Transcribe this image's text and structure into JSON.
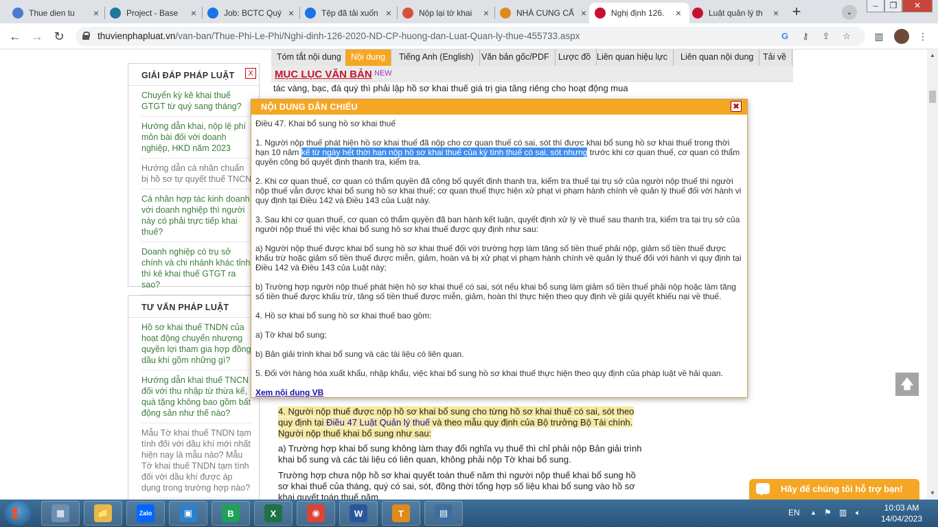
{
  "browser": {
    "tabs": [
      {
        "title": "Thue dien tu",
        "icon": "globe-icon",
        "color": "#4a7bd0"
      },
      {
        "title": "Project - Base",
        "icon": "wordpress-icon",
        "color": "#21759b"
      },
      {
        "title": "Job: BCTC Quý",
        "icon": "job-icon",
        "color": "#1a73e8"
      },
      {
        "title": "Tệp đã tải xuốn",
        "icon": "download-icon",
        "color": "#1a73e8"
      },
      {
        "title": "Nộp lại tờ khai",
        "icon": "tax-icon",
        "color": "#d4513d"
      },
      {
        "title": "NHÀ CUNG CẤ",
        "icon": "supplier-icon",
        "color": "#e08a1e"
      },
      {
        "title": "Nghị định 126.",
        "icon": "tvpl-icon",
        "color": "#c8102e"
      },
      {
        "title": "Luật quản lý th",
        "icon": "tvpl-icon",
        "color": "#c8102e"
      }
    ],
    "url_host": "thuvienphapluat.vn",
    "url_path": "/van-ban/Thue-Phi-Le-Phi/Nghi-dinh-126-2020-ND-CP-huong-dan-Luat-Quan-ly-thue-455733.aspx"
  },
  "sidebar": {
    "faq_title": "GIẢI ĐÁP PHÁP LUẬT",
    "faq_close": "X",
    "faq_items": [
      "Chuyển kỳ kê khai thuế GTGT từ quý sang tháng?",
      "Hướng dẫn khai, nộp lệ phí môn bài đối với doanh nghiệp, HKD năm 2023",
      "Hướng dẫn cá nhân chuẩn bị hồ sơ tự quyết thuế TNCN",
      "Cá nhân hợp tác kinh doanh với doanh nghiệp thì người này có phải trực tiếp khai thuế?",
      "Doanh nghiệp có trụ sở chính và chi nhánh khác tỉnh thì kê khai thuế GTGT ra sao?"
    ],
    "advice_title": "TƯ VẤN PHÁP LUẬT",
    "advice_items": [
      "Hồ sơ khai thuế TNDN của hoạt động chuyển nhượng quyền lợi tham gia hợp đồng dầu khí gồm những gì?",
      "Hướng dẫn khai thuế TNCN đối với thu nhập từ thừa kế, quà tặng không bao gồm bất động sản như thế nào?",
      "Mẫu Tờ khai thuế TNDN tạm tính đối với dầu khí mới nhất hiện nay là mẫu nào? Mẫu Tờ khai thuế TNDN tạm tính đối với dầu khí được áp dụng trong trường hợp nào?"
    ]
  },
  "page_tabs": [
    {
      "label": "Tóm tắt nội dung",
      "active": false
    },
    {
      "label": "Nội dung",
      "active": true
    },
    {
      "label": "Tiếng Anh (English)",
      "active": false
    },
    {
      "label": "Văn bản gốc/PDF",
      "active": false
    },
    {
      "label": "Lược đồ",
      "active": false
    },
    {
      "label": "Liên quan hiệu lực",
      "active": false
    },
    {
      "label": "Liên quan nội dung",
      "active": false
    },
    {
      "label": "Tải về",
      "active": false
    }
  ],
  "toc": {
    "title": "MỤC LỤC VĂN BẢN",
    "badge": "NEW"
  },
  "doc": {
    "top_line": "tác vàng, bạc, đá quý thì phải lập hồ sơ khai thuế giá trị gia tăng riêng cho hoạt động mua",
    "item4_a": "4. Người nộp thuế được nộp hồ sơ khai bổ sung cho từng hồ sơ khai thuế có sai, sót theo quy định tại ",
    "item4_link": "Điều 47 Luật Quản lý thuế",
    "item4_b": " và theo mẫu quy định của Bộ trưởng Bộ Tài chính. Người nộp thuế khai bổ sung như sau:",
    "item_a": "a) Trường hợp khai bổ sung không làm thay đổi nghĩa vụ thuế thì chỉ phải nộp Bản giải trình khai bổ sung và các tài liệu có liên quan, không phải nộp Tờ khai bổ sung.",
    "item_a2": "Trường hợp chưa nộp hồ sơ khai quyết toán thuế năm thì người nộp thuế khai bổ sung hồ sơ khai thuế của tháng, quý có sai, sót, đồng thời tổng hợp số liệu khai bổ sung vào hồ sơ khai quyết toán thuế năm."
  },
  "modal": {
    "title": "NỘI DUNG DẪN CHIẾU",
    "close_glyph": "✖",
    "heading": "Điều 47. Khai bổ sung hồ sơ khai thuế",
    "p1_a": "1. Người nộp thuế phát hiện hồ sơ khai thuế đã nộp cho cơ quan thuế có sai, sót thì được khai bổ sung hồ sơ khai thuế trong thời hạn 10 năm ",
    "p1_sel": "kể từ ngày hết thời hạn nộp hồ sơ khai thuế của kỳ tính thuế có sai, sót nhưng",
    "p1_b": " trước khi cơ quan thuế, cơ quan có thẩm quyền công bố quyết định thanh tra, kiểm tra.",
    "p2": "2. Khi cơ quan thuế, cơ quan có thẩm quyền đã công bố quyết định thanh tra, kiểm tra thuế tại trụ sở của người nộp thuế thì người nộp thuế vẫn được khai bổ sung hồ sơ khai thuế; cơ quan thuế thực hiện xử phạt vi phạm hành chính về quản lý thuế đối với hành vi quy định tại Điều 142 và Điều 143 của Luật này.",
    "p3": "3. Sau khi cơ quan thuế, cơ quan có thẩm quyền đã ban hành kết luận, quyết định xử lý về thuế sau thanh tra, kiểm tra tại trụ sở của người nộp thuế thì việc khai bổ sung hồ sơ khai thuế được quy định như sau:",
    "p3a": "a) Người nộp thuế được khai bổ sung hồ sơ khai thuế đối với trường hợp làm tăng số tiền thuế phải nộp, giảm số tiền thuế được khấu trừ hoặc giảm số tiền thuế được miễn, giảm, hoàn và bị xử phạt vi phạm hành chính về quản lý thuế đối với hành vi quy định tại Điều 142 và Điều 143 của Luật này;",
    "p3b": "b) Trường hợp người nộp thuế phát hiện hồ sơ khai thuế có sai, sót nếu khai bổ sung làm giảm số tiền thuế phải nộp hoặc làm tăng số tiền thuế được khấu trừ, tăng số tiền thuế được miễn, giảm, hoàn thì thực hiện theo quy định về giải quyết khiếu nại về thuế.",
    "p4": "4. Hồ sơ khai bổ sung hồ sơ khai thuế bao gồm:",
    "p4a": "a) Tờ khai bổ sung;",
    "p4b": "b) Bản giải trình khai bổ sung và các tài liệu có liên quan.",
    "p5": "5. Đối với hàng hóa xuất khẩu, nhập khẩu, việc khai bổ sung hồ sơ khai thuế thực hiện theo quy định của pháp luật về hải quan.",
    "link": "Xem nội dung VB"
  },
  "floating": {
    "to_top": "🡅",
    "support": "Hãy để chúng tôi hỗ trợ bạn!"
  },
  "taskbar": {
    "apps": [
      {
        "name": "calculator-icon",
        "label": "▦",
        "color": "#6f8fb0"
      },
      {
        "name": "file-explorer-icon",
        "label": "📁",
        "color": "#e8b84a"
      },
      {
        "name": "zalo-icon",
        "label": "Zalo",
        "color": "#0068ff"
      },
      {
        "name": "remote-desktop-icon",
        "label": "▣",
        "color": "#2f7fc9"
      },
      {
        "name": "b-app-icon",
        "label": "B",
        "color": "#1fa15a"
      },
      {
        "name": "excel-icon",
        "label": "X",
        "color": "#1e7145"
      },
      {
        "name": "chrome-icon",
        "label": "◉",
        "color": "#db4437"
      },
      {
        "name": "word-icon",
        "label": "W",
        "color": "#2b579a"
      },
      {
        "name": "supplier-app-icon",
        "label": "T",
        "color": "#e08a1e"
      },
      {
        "name": "table-app-icon",
        "label": "▤",
        "color": "#3d6f9e"
      }
    ],
    "lang": "EN",
    "time": "10:03 AM",
    "date": "14/04/2023"
  }
}
